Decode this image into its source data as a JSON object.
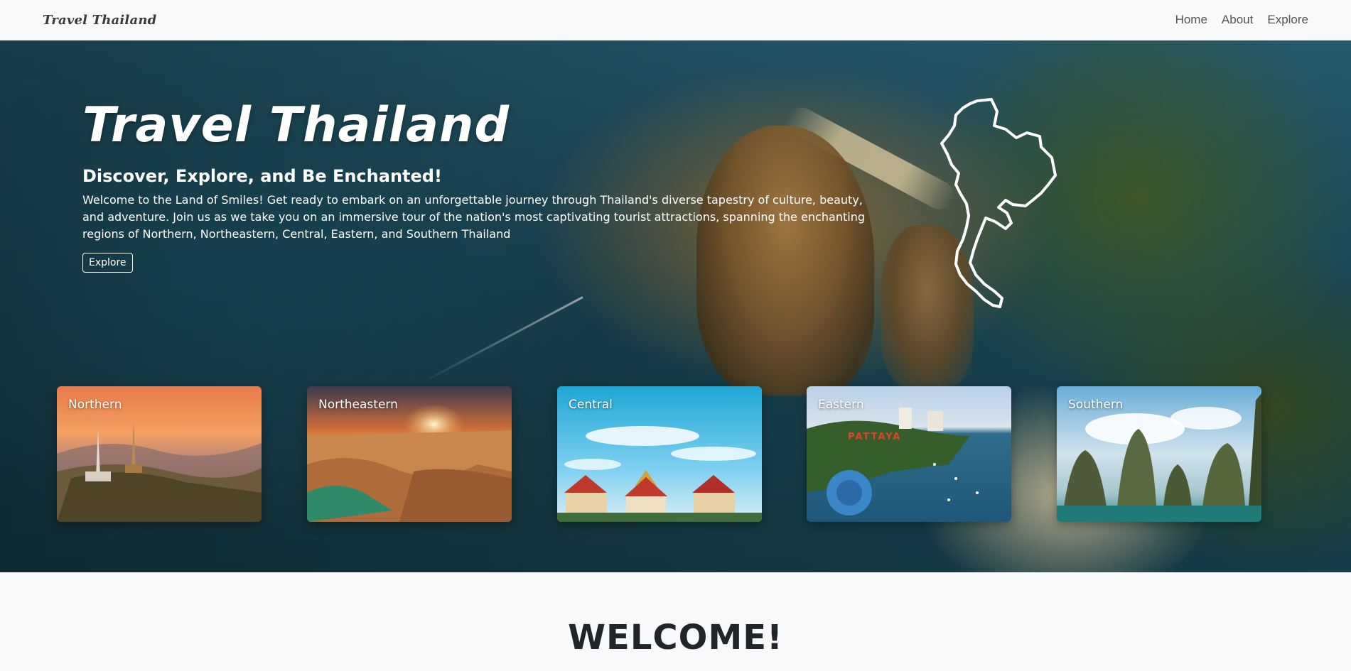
{
  "nav": {
    "brand": "Travel Thailand",
    "links": [
      "Home",
      "About",
      "Explore"
    ]
  },
  "hero": {
    "title": "Travel Thailand",
    "subtitle": "Discover, Explore, and Be Enchanted!",
    "text": "Welcome to the Land of Smiles! Get ready to embark on an unforgettable journey through Thailand's diverse tapestry of culture, beauty, and adventure. Join us as we take you on an immersive tour of the nation's most captivating tourist attractions, spanning the enchanting regions of Northern, Northeastern, Central, Eastern, and Southern Thailand",
    "button": "Explore"
  },
  "regions": [
    {
      "label": "Northern"
    },
    {
      "label": "Northeastern"
    },
    {
      "label": "Central"
    },
    {
      "label": "Eastern",
      "sign": "PATTAYA"
    },
    {
      "label": "Southern"
    }
  ],
  "welcome": "WELCOME!",
  "colors": {
    "nav_bg": "#f8f9fa",
    "hero_water": "#1f5a6e",
    "text_light": "#ffffff",
    "text_dark": "#212529"
  },
  "icons": {
    "map": "thailand-map-outline-icon"
  }
}
